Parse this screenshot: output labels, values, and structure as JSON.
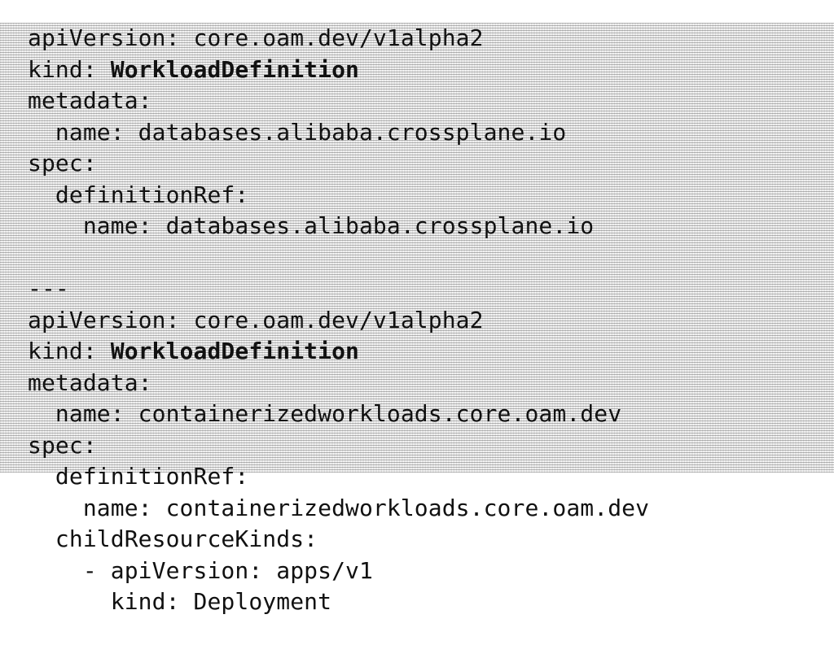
{
  "document": {
    "lines": [
      "apiVersion: core.oam.dev/v1alpha2",
      "kind: WorkloadDefinition",
      "metadata:",
      "  name: databases.alibaba.crossplane.io",
      "spec:",
      "  definitionRef:",
      "    name: databases.alibaba.crossplane.io",
      "",
      "---",
      "apiVersion: core.oam.dev/v1alpha2",
      "kind: WorkloadDefinition",
      "metadata:",
      "  name: containerizedworkloads.core.oam.dev",
      "spec:",
      "  definitionRef:",
      "    name: containerizedworkloads.core.oam.dev",
      "  childResourceKinds:",
      "    - apiVersion: apps/v1",
      "      kind: Deployment"
    ]
  }
}
